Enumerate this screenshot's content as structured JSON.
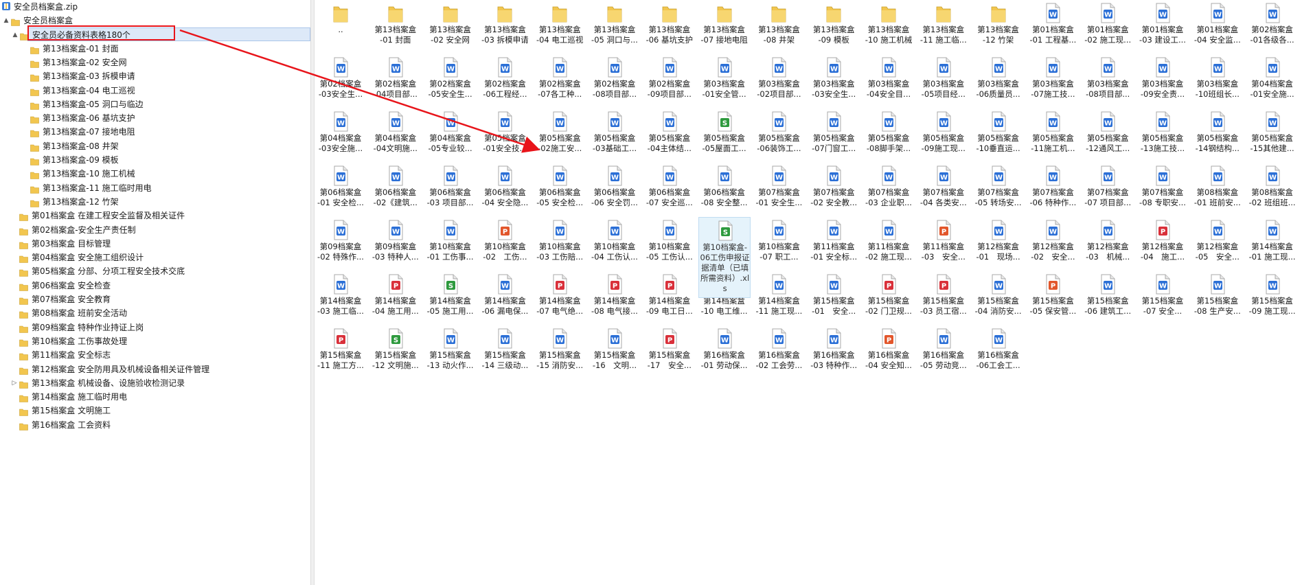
{
  "tree": {
    "root": {
      "label": "安全员档案盒.zip",
      "icon": "zip-archive-icon"
    },
    "rows": [
      {
        "label": "安全员档案盒",
        "level": 1,
        "expander": "▲",
        "selected": false
      },
      {
        "label": "安全员必备资料表格180个",
        "level": 2,
        "expander": "▲",
        "selected": true
      },
      {
        "label": "第13档案盒-01 封面",
        "level": 3,
        "expander": "",
        "selected": false
      },
      {
        "label": "第13档案盒-02 安全网",
        "level": 3,
        "expander": "",
        "selected": false
      },
      {
        "label": "第13档案盒-03 拆模申请",
        "level": 3,
        "expander": "",
        "selected": false
      },
      {
        "label": "第13档案盒-04 电工巡视",
        "level": 3,
        "expander": "",
        "selected": false
      },
      {
        "label": "第13档案盒-05 洞口与临边",
        "level": 3,
        "expander": "",
        "selected": false
      },
      {
        "label": "第13档案盒-06 基坑支护",
        "level": 3,
        "expander": "",
        "selected": false
      },
      {
        "label": "第13档案盒-07 接地电阻",
        "level": 3,
        "expander": "",
        "selected": false
      },
      {
        "label": "第13档案盒-08 井架",
        "level": 3,
        "expander": "",
        "selected": false
      },
      {
        "label": "第13档案盒-09 模板",
        "level": 3,
        "expander": "",
        "selected": false
      },
      {
        "label": "第13档案盒-10 施工机械",
        "level": 3,
        "expander": "",
        "selected": false
      },
      {
        "label": "第13档案盒-11 施工临时用电",
        "level": 3,
        "expander": "",
        "selected": false
      },
      {
        "label": "第13档案盒-12 竹架",
        "level": 3,
        "expander": "",
        "selected": false
      },
      {
        "label": "第01档案盒 在建工程安全监督及相关证件",
        "level": 2,
        "expander": "",
        "selected": false
      },
      {
        "label": "第02档案盒-安全生产责任制",
        "level": 2,
        "expander": "",
        "selected": false
      },
      {
        "label": "第03档案盒 目标管理",
        "level": 2,
        "expander": "",
        "selected": false
      },
      {
        "label": "第04档案盒 安全施工组织设计",
        "level": 2,
        "expander": "",
        "selected": false
      },
      {
        "label": "第05档案盒 分部、分项工程安全技术交底",
        "level": 2,
        "expander": "",
        "selected": false
      },
      {
        "label": "第06档案盒 安全检查",
        "level": 2,
        "expander": "",
        "selected": false
      },
      {
        "label": "第07档案盒 安全教育",
        "level": 2,
        "expander": "",
        "selected": false
      },
      {
        "label": "第08档案盒 班前安全活动",
        "level": 2,
        "expander": "",
        "selected": false
      },
      {
        "label": "第09档案盒 特种作业持证上岗",
        "level": 2,
        "expander": "",
        "selected": false
      },
      {
        "label": "第10档案盒 工伤事故处理",
        "level": 2,
        "expander": "",
        "selected": false
      },
      {
        "label": "第11档案盒 安全标志",
        "level": 2,
        "expander": "",
        "selected": false
      },
      {
        "label": "第12档案盒 安全防用具及机械设备相关证件管理",
        "level": 2,
        "expander": "",
        "selected": false
      },
      {
        "label": "第13档案盒 机械设备、设施验收检测记录",
        "level": 2,
        "expander": "▷",
        "selected": false
      },
      {
        "label": "第14档案盒 施工临时用电",
        "level": 2,
        "expander": "",
        "selected": false
      },
      {
        "label": "第15档案盒 文明施工",
        "level": 2,
        "expander": "",
        "selected": false
      },
      {
        "label": "第16档案盒 工会资料",
        "level": 2,
        "expander": "",
        "selected": false
      }
    ]
  },
  "icon_colors": {
    "folder": "#f2c64f",
    "word": "#2b6fd6",
    "excel": "#2e9a3e",
    "ppt": "#e2562b",
    "pdf": "#d9303a"
  },
  "annotation": {
    "box_color": "#e8141a",
    "arrow_color": "#e8141a"
  },
  "grid": {
    "rows": [
      [
        {
          "t": "folder",
          "l1": "..",
          "l2": ""
        },
        {
          "t": "folder",
          "l1": "第13档案盒",
          "l2": "-01 封面"
        },
        {
          "t": "folder",
          "l1": "第13档案盒",
          "l2": "-02 安全网"
        },
        {
          "t": "folder",
          "l1": "第13档案盒",
          "l2": "-03 拆模申请"
        },
        {
          "t": "folder",
          "l1": "第13档案盒",
          "l2": "-04 电工巡视"
        },
        {
          "t": "folder",
          "l1": "第13档案盒",
          "l2": "-05 洞口与..."
        },
        {
          "t": "folder",
          "l1": "第13档案盒",
          "l2": "-06 基坑支护"
        },
        {
          "t": "folder",
          "l1": "第13档案盒",
          "l2": "-07 接地电阻"
        },
        {
          "t": "folder",
          "l1": "第13档案盒",
          "l2": "-08 井架"
        },
        {
          "t": "folder",
          "l1": "第13档案盒",
          "l2": "-09 模板"
        },
        {
          "t": "folder",
          "l1": "第13档案盒",
          "l2": "-10 施工机械"
        },
        {
          "t": "folder",
          "l1": "第13档案盒",
          "l2": "-11 施工临..."
        },
        {
          "t": "folder",
          "l1": "第13档案盒",
          "l2": "-12 竹架"
        },
        {
          "t": "word",
          "l1": "第01档案盒",
          "l2": "-01 工程基..."
        },
        {
          "t": "word",
          "l1": "第01档案盒",
          "l2": "-02 施工现..."
        },
        {
          "t": "word",
          "l1": "第01档案盒",
          "l2": "-03 建设工..."
        },
        {
          "t": "word",
          "l1": "第01档案盒",
          "l2": "-04 安全监..."
        },
        {
          "t": "word",
          "l1": "第02档案盒",
          "l2": "-01各级各..."
        },
        {
          "t": "word",
          "l1": "第02档案盒",
          "l2": "-02管理人..."
        }
      ],
      [
        {
          "t": "word",
          "l1": "第02档案盒",
          "l2": "-03安全生..."
        },
        {
          "t": "word",
          "l1": "第02档案盒",
          "l2": "-04项目部..."
        },
        {
          "t": "word",
          "l1": "第02档案盒",
          "l2": "-05安全生..."
        },
        {
          "t": "word",
          "l1": "第02档案盒",
          "l2": "-06工程经..."
        },
        {
          "t": "word",
          "l1": "第02档案盒",
          "l2": "-07各工种..."
        },
        {
          "t": "word",
          "l1": "第02档案盒",
          "l2": "-08项目部..."
        },
        {
          "t": "word",
          "l1": "第02档案盒",
          "l2": "-09项目部..."
        },
        {
          "t": "word",
          "l1": "第03档案盒",
          "l2": "-01安全管..."
        },
        {
          "t": "word",
          "l1": "第03档案盒",
          "l2": "-02项目部..."
        },
        {
          "t": "word",
          "l1": "第03档案盒",
          "l2": "-03安全生..."
        },
        {
          "t": "word",
          "l1": "第03档案盒",
          "l2": "-04安全目..."
        },
        {
          "t": "word",
          "l1": "第03档案盒",
          "l2": "-05项目经..."
        },
        {
          "t": "word",
          "l1": "第03档案盒",
          "l2": "-06质量员..."
        },
        {
          "t": "word",
          "l1": "第03档案盒",
          "l2": "-07施工技..."
        },
        {
          "t": "word",
          "l1": "第03档案盒",
          "l2": "-08项目部..."
        },
        {
          "t": "word",
          "l1": "第03档案盒",
          "l2": "-09安全责..."
        },
        {
          "t": "word",
          "l1": "第03档案盒",
          "l2": "-10班组长..."
        },
        {
          "t": "word",
          "l1": "第04档案盒",
          "l2": "-01安全施..."
        },
        {
          "t": "word",
          "l1": "第04档案盒",
          "l2": "-02施工组..."
        }
      ],
      [
        {
          "t": "word",
          "l1": "第04档案盒",
          "l2": "-03安全施..."
        },
        {
          "t": "word",
          "l1": "第04档案盒",
          "l2": "-04文明施..."
        },
        {
          "t": "word",
          "l1": "第04档案盒",
          "l2": "-05专业较..."
        },
        {
          "t": "word",
          "l1": "第05档案盒",
          "l2": "-01安全技..."
        },
        {
          "t": "word",
          "l1": "第05档案盒",
          "l2": "-02施工安..."
        },
        {
          "t": "word",
          "l1": "第05档案盒",
          "l2": "-03基础工..."
        },
        {
          "t": "word",
          "l1": "第05档案盒",
          "l2": "-04主体结..."
        },
        {
          "t": "excel",
          "l1": "第05档案盒",
          "l2": "-05屋面工..."
        },
        {
          "t": "word",
          "l1": "第05档案盒",
          "l2": "-06装饰工..."
        },
        {
          "t": "word",
          "l1": "第05档案盒",
          "l2": "-07门窗工..."
        },
        {
          "t": "word",
          "l1": "第05档案盒",
          "l2": "-08脚手架..."
        },
        {
          "t": "word",
          "l1": "第05档案盒",
          "l2": "-09施工现..."
        },
        {
          "t": "word",
          "l1": "第05档案盒",
          "l2": "-10垂直运..."
        },
        {
          "t": "word",
          "l1": "第05档案盒",
          "l2": "-11施工机..."
        },
        {
          "t": "word",
          "l1": "第05档案盒",
          "l2": "-12通风工..."
        },
        {
          "t": "word",
          "l1": "第05档案盒",
          "l2": "-13施工技..."
        },
        {
          "t": "word",
          "l1": "第05档案盒",
          "l2": "-14钢结构..."
        },
        {
          "t": "word",
          "l1": "第05档案盒",
          "l2": "-15其他建..."
        },
        {
          "t": "word",
          "l1": "第05档案盒",
          "l2": "-16拆除工..."
        }
      ],
      [
        {
          "t": "word",
          "l1": "第06档案盒",
          "l2": "-01 安全检..."
        },
        {
          "t": "word",
          "l1": "第06档案盒",
          "l2": "-02《建筑..."
        },
        {
          "t": "word",
          "l1": "第06档案盒",
          "l2": "-03 项目部..."
        },
        {
          "t": "word",
          "l1": "第06档案盒",
          "l2": "-04 安全隐..."
        },
        {
          "t": "word",
          "l1": "第06档案盒",
          "l2": "-05 安全检..."
        },
        {
          "t": "word",
          "l1": "第06档案盒",
          "l2": "-06 安全罚..."
        },
        {
          "t": "word",
          "l1": "第06档案盒",
          "l2": "-07 安全巡..."
        },
        {
          "t": "word",
          "l1": "第06档案盒",
          "l2": "-08 安全整..."
        },
        {
          "t": "word",
          "l1": "第07档案盒",
          "l2": "-01 安全生..."
        },
        {
          "t": "word",
          "l1": "第07档案盒",
          "l2": "-02 安全教..."
        },
        {
          "t": "word",
          "l1": "第07档案盒",
          "l2": "-03 企业职..."
        },
        {
          "t": "word",
          "l1": "第07档案盒",
          "l2": "-04 各类安..."
        },
        {
          "t": "word",
          "l1": "第07档案盒",
          "l2": "-05 转场安..."
        },
        {
          "t": "word",
          "l1": "第07档案盒",
          "l2": "-06 特种作..."
        },
        {
          "t": "word",
          "l1": "第07档案盒",
          "l2": "-07 项目部..."
        },
        {
          "t": "word",
          "l1": "第07档案盒",
          "l2": "-08 专职安..."
        },
        {
          "t": "word",
          "l1": "第08档案盒",
          "l2": "-01 班前安..."
        },
        {
          "t": "word",
          "l1": "第08档案盒",
          "l2": "-02 班组班..."
        },
        {
          "t": "word",
          "l1": "第09档案盒",
          "l2": "-01 特种作..."
        }
      ],
      [
        {
          "t": "word",
          "l1": "第09档案盒",
          "l2": "-02 特殊作..."
        },
        {
          "t": "word",
          "l1": "第09档案盒",
          "l2": "-03 特种人..."
        },
        {
          "t": "word",
          "l1": "第10档案盒",
          "l2": "-01 工伤事..."
        },
        {
          "t": "ppt",
          "l1": "第10档案盒",
          "l2": "-02　工伤..."
        },
        {
          "t": "word",
          "l1": "第10档案盒",
          "l2": "-03 工伤赔..."
        },
        {
          "t": "word",
          "l1": "第10档案盒",
          "l2": "-04 工伤认..."
        },
        {
          "t": "word",
          "l1": "第10档案盒",
          "l2": "-05 工伤认..."
        },
        {
          "t": "excel",
          "l1": "第10档案盒-",
          "l2": "06工伤申报证据清单（已填所需资料）.xls",
          "hover": true
        },
        {
          "t": "word",
          "l1": "第10档案盒",
          "l2": "-07 职工..."
        },
        {
          "t": "word",
          "l1": "第11档案盒",
          "l2": "-01 安全标..."
        },
        {
          "t": "word",
          "l1": "第11档案盒",
          "l2": "-02 施工现..."
        },
        {
          "t": "ppt",
          "l1": "第11档案盒",
          "l2": "-03　安全..."
        },
        {
          "t": "word",
          "l1": "第12档案盒",
          "l2": "-01　现场..."
        },
        {
          "t": "word",
          "l1": "第12档案盒",
          "l2": "-02　安全..."
        },
        {
          "t": "word",
          "l1": "第12档案盒",
          "l2": "-03　机械..."
        },
        {
          "t": "pdf",
          "l1": "第12档案盒",
          "l2": "-04　施工..."
        },
        {
          "t": "word",
          "l1": "第12档案盒",
          "l2": "-05　安全..."
        },
        {
          "t": "word",
          "l1": "第14档案盒",
          "l2": "-01 施工现..."
        },
        {
          "t": "word",
          "l1": "第14档案盒",
          "l2": "-02 电工岗..."
        }
      ],
      [
        {
          "t": "word",
          "l1": "第14档案盒",
          "l2": "-03 施工临..."
        },
        {
          "t": "pdf",
          "l1": "第14档案盒",
          "l2": "-04 施工用..."
        },
        {
          "t": "excel",
          "l1": "第14档案盒",
          "l2": "-05 施工用..."
        },
        {
          "t": "word",
          "l1": "第14档案盒",
          "l2": "-06 漏电保..."
        },
        {
          "t": "pdf",
          "l1": "第14档案盒",
          "l2": "-07 电气绝..."
        },
        {
          "t": "pdf",
          "l1": "第14档案盒",
          "l2": "-08 电气接..."
        },
        {
          "t": "pdf",
          "l1": "第14档案盒",
          "l2": "-09 电工日..."
        },
        {
          "t": "word",
          "l1": "第14档案盒",
          "l2": "-10 电工维..."
        },
        {
          "t": "word",
          "l1": "第14档案盒",
          "l2": "-11 施工现..."
        },
        {
          "t": "word",
          "l1": "第15档案盒",
          "l2": "-01　安全..."
        },
        {
          "t": "pdf",
          "l1": "第15档案盒",
          "l2": "-02 门卫规..."
        },
        {
          "t": "pdf",
          "l1": "第15档案盒",
          "l2": "-03 员工宿..."
        },
        {
          "t": "word",
          "l1": "第15档案盒",
          "l2": "-04 消防安..."
        },
        {
          "t": "ppt",
          "l1": "第15档案盒",
          "l2": "-05 保安管..."
        },
        {
          "t": "word",
          "l1": "第15档案盒",
          "l2": "-06 建筑工..."
        },
        {
          "t": "word",
          "l1": "第15档案盒",
          "l2": "-07 安全..."
        },
        {
          "t": "word",
          "l1": "第15档案盒",
          "l2": "-08 生产安..."
        },
        {
          "t": "word",
          "l1": "第15档案盒",
          "l2": "-09 施工现..."
        },
        {
          "t": "word",
          "l1": "第15档案盒",
          "l2": "-10 进入施..."
        }
      ],
      [
        {
          "t": "pdf",
          "l1": "第15档案盒",
          "l2": "-11 施工方..."
        },
        {
          "t": "excel",
          "l1": "第15档案盒",
          "l2": "-12 文明施..."
        },
        {
          "t": "word",
          "l1": "第15档案盒",
          "l2": "-13 动火作..."
        },
        {
          "t": "word",
          "l1": "第15档案盒",
          "l2": "-14 三级动..."
        },
        {
          "t": "word",
          "l1": "第15档案盒",
          "l2": "-15 消防安..."
        },
        {
          "t": "word",
          "l1": "第15档案盒",
          "l2": "-16　文明..."
        },
        {
          "t": "pdf",
          "l1": "第15档案盒",
          "l2": "-17　安全..."
        },
        {
          "t": "word",
          "l1": "第16档案盒",
          "l2": "-01 劳动保..."
        },
        {
          "t": "word",
          "l1": "第16档案盒",
          "l2": "-02 工会劳..."
        },
        {
          "t": "word",
          "l1": "第16档案盒",
          "l2": "-03 特种作..."
        },
        {
          "t": "ppt",
          "l1": "第16档案盒",
          "l2": "-04 安全知..."
        },
        {
          "t": "word",
          "l1": "第16档案盒",
          "l2": "-05 劳动竞..."
        },
        {
          "t": "word",
          "l1": "第16档案盒",
          "l2": "-06工会工..."
        }
      ]
    ]
  }
}
